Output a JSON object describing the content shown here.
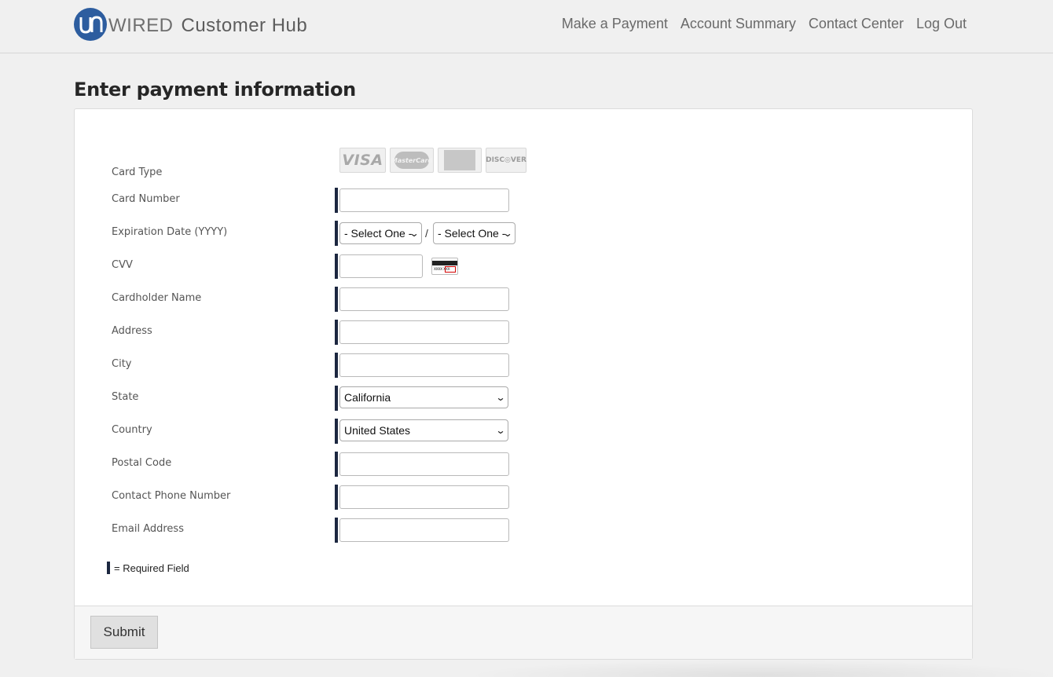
{
  "header": {
    "logo_letters": "UN",
    "brand_word": "WIRED",
    "brand_suffix": "Customer Hub",
    "nav": [
      "Make a Payment",
      "Account Summary",
      "Contact Center",
      "Log Out"
    ]
  },
  "page": {
    "title": "Enter payment information"
  },
  "form": {
    "card_type_label": "Card Type",
    "card_brands": [
      "VISA",
      "MasterCard",
      "American Express",
      "DISCOVER"
    ],
    "card_number_label": "Card Number",
    "expiration_label": "Expiration Date (YYYY)",
    "exp_month_value": "- Select One -",
    "exp_year_value": "- Select One -",
    "exp_separator": "/",
    "cvv_label": "CVV",
    "cvv_icon_text": "xxxx xxx",
    "cardholder_label": "Cardholder Name",
    "address_label": "Address",
    "city_label": "City",
    "state_label": "State",
    "state_value": "California",
    "country_label": "Country",
    "country_value": "United States",
    "postal_label": "Postal Code",
    "phone_label": "Contact Phone Number",
    "email_label": "Email Address",
    "required_legend": "= Required Field"
  },
  "footer": {
    "submit_label": "Submit"
  },
  "colors": {
    "background": "#f0f0f0",
    "logo_blue": "#2d5d9f",
    "required_bar": "#1c2740",
    "panel": "#ffffff"
  }
}
